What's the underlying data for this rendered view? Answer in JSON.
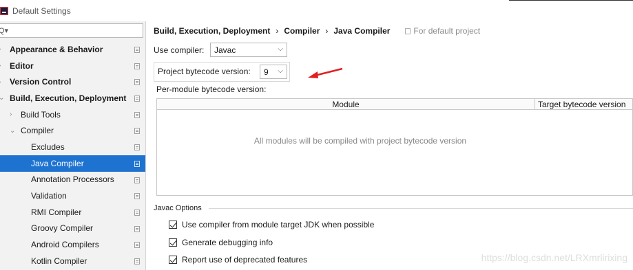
{
  "window": {
    "title": "Default Settings"
  },
  "sidebar": {
    "search_placeholder": "",
    "items": [
      {
        "label": "Appearance & Behavior",
        "level": 0,
        "arrow": "›",
        "bold": true
      },
      {
        "label": "Editor",
        "level": 0,
        "arrow": "›",
        "bold": true
      },
      {
        "label": "Version Control",
        "level": 0,
        "arrow": "›",
        "bold": true
      },
      {
        "label": "Build, Execution, Deployment",
        "level": 0,
        "arrow": "⌄",
        "bold": true
      },
      {
        "label": "Build Tools",
        "level": 1,
        "arrow": "›",
        "bold": false
      },
      {
        "label": "Compiler",
        "level": 1,
        "arrow": "⌄",
        "bold": false
      },
      {
        "label": "Excludes",
        "level": 2,
        "arrow": "",
        "bold": false
      },
      {
        "label": "Java Compiler",
        "level": 2,
        "arrow": "",
        "bold": false,
        "selected": true
      },
      {
        "label": "Annotation Processors",
        "level": 2,
        "arrow": "",
        "bold": false
      },
      {
        "label": "Validation",
        "level": 2,
        "arrow": "",
        "bold": false
      },
      {
        "label": "RMI Compiler",
        "level": 2,
        "arrow": "",
        "bold": false
      },
      {
        "label": "Groovy Compiler",
        "level": 2,
        "arrow": "",
        "bold": false
      },
      {
        "label": "Android Compilers",
        "level": 2,
        "arrow": "",
        "bold": false
      },
      {
        "label": "Kotlin Compiler",
        "level": 2,
        "arrow": "",
        "bold": false
      }
    ]
  },
  "main": {
    "breadcrumb": [
      "Build, Execution, Deployment",
      "Compiler",
      "Java Compiler"
    ],
    "breadcrumb_sep": "›",
    "scope_label": "For default project",
    "use_compiler_label": "Use compiler:",
    "use_compiler_value": "Javac",
    "bytecode_label": "Project bytecode version:",
    "bytecode_value": "9",
    "per_module_label": "Per-module bytecode version:",
    "table": {
      "columns": [
        "Module",
        "Target bytecode version"
      ],
      "empty_text": "All modules will be compiled with project bytecode version"
    },
    "javac_options_title": "Javac Options",
    "options": [
      {
        "label": "Use compiler from module target JDK when possible",
        "checked": true
      },
      {
        "label": "Generate debugging info",
        "checked": true
      },
      {
        "label": "Report use of deprecated features",
        "checked": true
      }
    ]
  },
  "watermark": "https://blog.csdn.net/LRXmrlirixing",
  "colors": {
    "selection": "#1e73d1",
    "arrow": "#e02020"
  },
  "icons": {
    "dropdown": "chevron-down-icon",
    "tree_collapsed": "chevron-right-icon",
    "tree_expanded": "chevron-down-icon",
    "search": "search-icon",
    "copy": "copy-icon"
  }
}
